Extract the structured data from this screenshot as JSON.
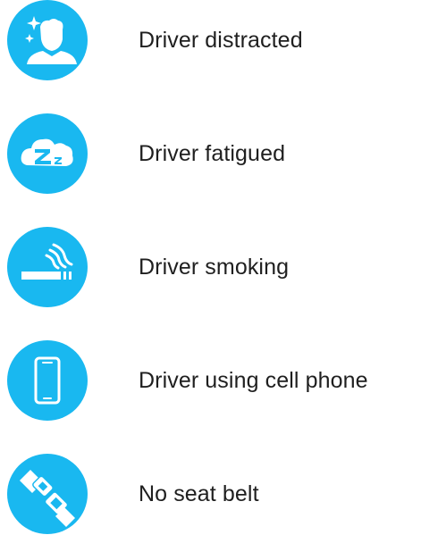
{
  "accent_color": "#19b8f0",
  "items": [
    {
      "label": "Driver distracted",
      "icon": "distracted-driver-icon"
    },
    {
      "label": "Driver fatigued",
      "icon": "sleep-zz-cloud-icon"
    },
    {
      "label": "Driver smoking",
      "icon": "cigarette-smoke-icon"
    },
    {
      "label": "Driver using cell phone",
      "icon": "cell-phone-icon"
    },
    {
      "label": "No seat belt",
      "icon": "seat-belt-buckle-icon"
    }
  ]
}
